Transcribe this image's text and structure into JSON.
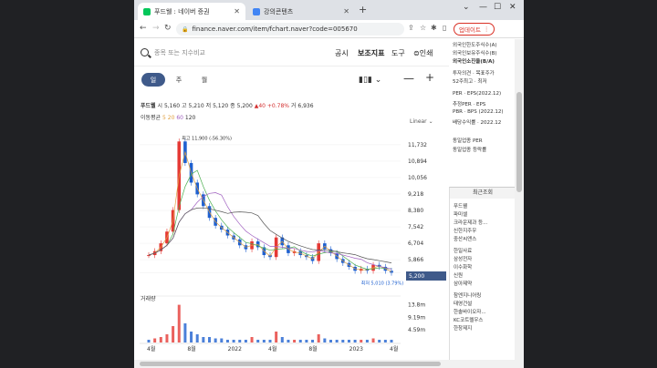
{
  "tabs": [
    {
      "label": "푸드웰 : 네이버 증권",
      "icon": "naver-favicon",
      "active": true
    },
    {
      "label": "강의콘텐츠",
      "icon": "doc-favicon",
      "active": false
    }
  ],
  "address": {
    "url": "finance.naver.com/item/fchart.naver?code=005670"
  },
  "update_button": "업데이트",
  "search": {
    "placeholder": "종목 또는 지수비교"
  },
  "menu": [
    "공시",
    "보조지표",
    "도구",
    "인쇄"
  ],
  "periods": [
    "일",
    "주",
    "월"
  ],
  "stock": {
    "name": "푸드웰",
    "open_label": "시",
    "open": "5,160",
    "high_label": "고",
    "high": "5,210",
    "low_label": "저",
    "low": "5,120",
    "close_label": "종",
    "close": "5,200",
    "change": "▲40",
    "change_pct": "+0.78%",
    "volume_label": "거",
    "volume": "6,936"
  },
  "ma": {
    "label": "이동평균",
    "v1": "5",
    "v2": "20",
    "v3": "60",
    "v4": "120"
  },
  "scale": "Linear",
  "volume_title": "거래량",
  "current_price_tag": "5,200",
  "sidebar": {
    "lines1": [
      "외국인한도주식수(A)",
      "외국인보유주식수(B)",
      "외국인소진율(B/A)",
      "투자의견 · 목표주가",
      "52주최고 · 최저"
    ],
    "lines2": [
      "PER · EPS(2022.12)",
      "추정PER · EPS",
      "PBR · BPS (2022.12)",
      "배당수익률 · 2022.12"
    ],
    "lines3": [
      "동일업종 PER",
      "동일업종 등락률"
    ],
    "recent_title": "최근조회",
    "recent": [
      "푸드웰",
      "파미셀",
      "크라운제과 등...",
      "신한지주우",
      "중산씨앤스",
      "",
      "한일사료",
      "삼성전자",
      "이수화학",
      "신원",
      "삼아제약",
      "",
      "참엔지니어링",
      "태영건설",
      "한솔바이오자...",
      "KC코트렐우스",
      "한창제지"
    ]
  },
  "chart_data": {
    "type": "candlestick",
    "title": "",
    "x_ticks": [
      "4월",
      "8월",
      "2022",
      "4월",
      "8월",
      "2023",
      "4월"
    ],
    "y_ticks": [
      "11,732",
      "10,894",
      "10,056",
      "9,218",
      "8,380",
      "7,542",
      "6,704",
      "5,866",
      "5,200"
    ],
    "ylim": [
      4800,
      12100
    ],
    "high_annotation": "최고 11,900 (-56.30%)",
    "low_annotation": "최저 5,010 (3.79%)",
    "volume_ticks": [
      "13.8m",
      "9.19m",
      "4.59m"
    ],
    "grid": true,
    "price_series_approx": [
      6100,
      6300,
      6700,
      7300,
      8400,
      11900,
      10800,
      9800,
      9200,
      8600,
      8000,
      7600,
      7400,
      7100,
      6900,
      6600,
      6400,
      6800,
      6500,
      6100,
      6000,
      7000,
      6600,
      6200,
      6300,
      6100,
      6000,
      5800,
      6700,
      6400,
      6200,
      5900,
      5700,
      5500,
      5300,
      5400,
      5300,
      5600,
      5500,
      5300,
      5200
    ],
    "volume_series_approx": [
      1,
      1.5,
      2,
      3,
      6,
      13.8,
      7,
      4,
      3,
      2,
      2,
      1.5,
      1.5,
      1,
      1,
      1,
      1,
      2,
      1,
      1,
      1,
      4,
      2,
      1,
      1,
      1,
      1,
      1,
      3,
      1.5,
      1,
      1,
      1,
      1,
      1,
      1,
      1,
      1.5,
      1,
      1,
      1
    ]
  }
}
